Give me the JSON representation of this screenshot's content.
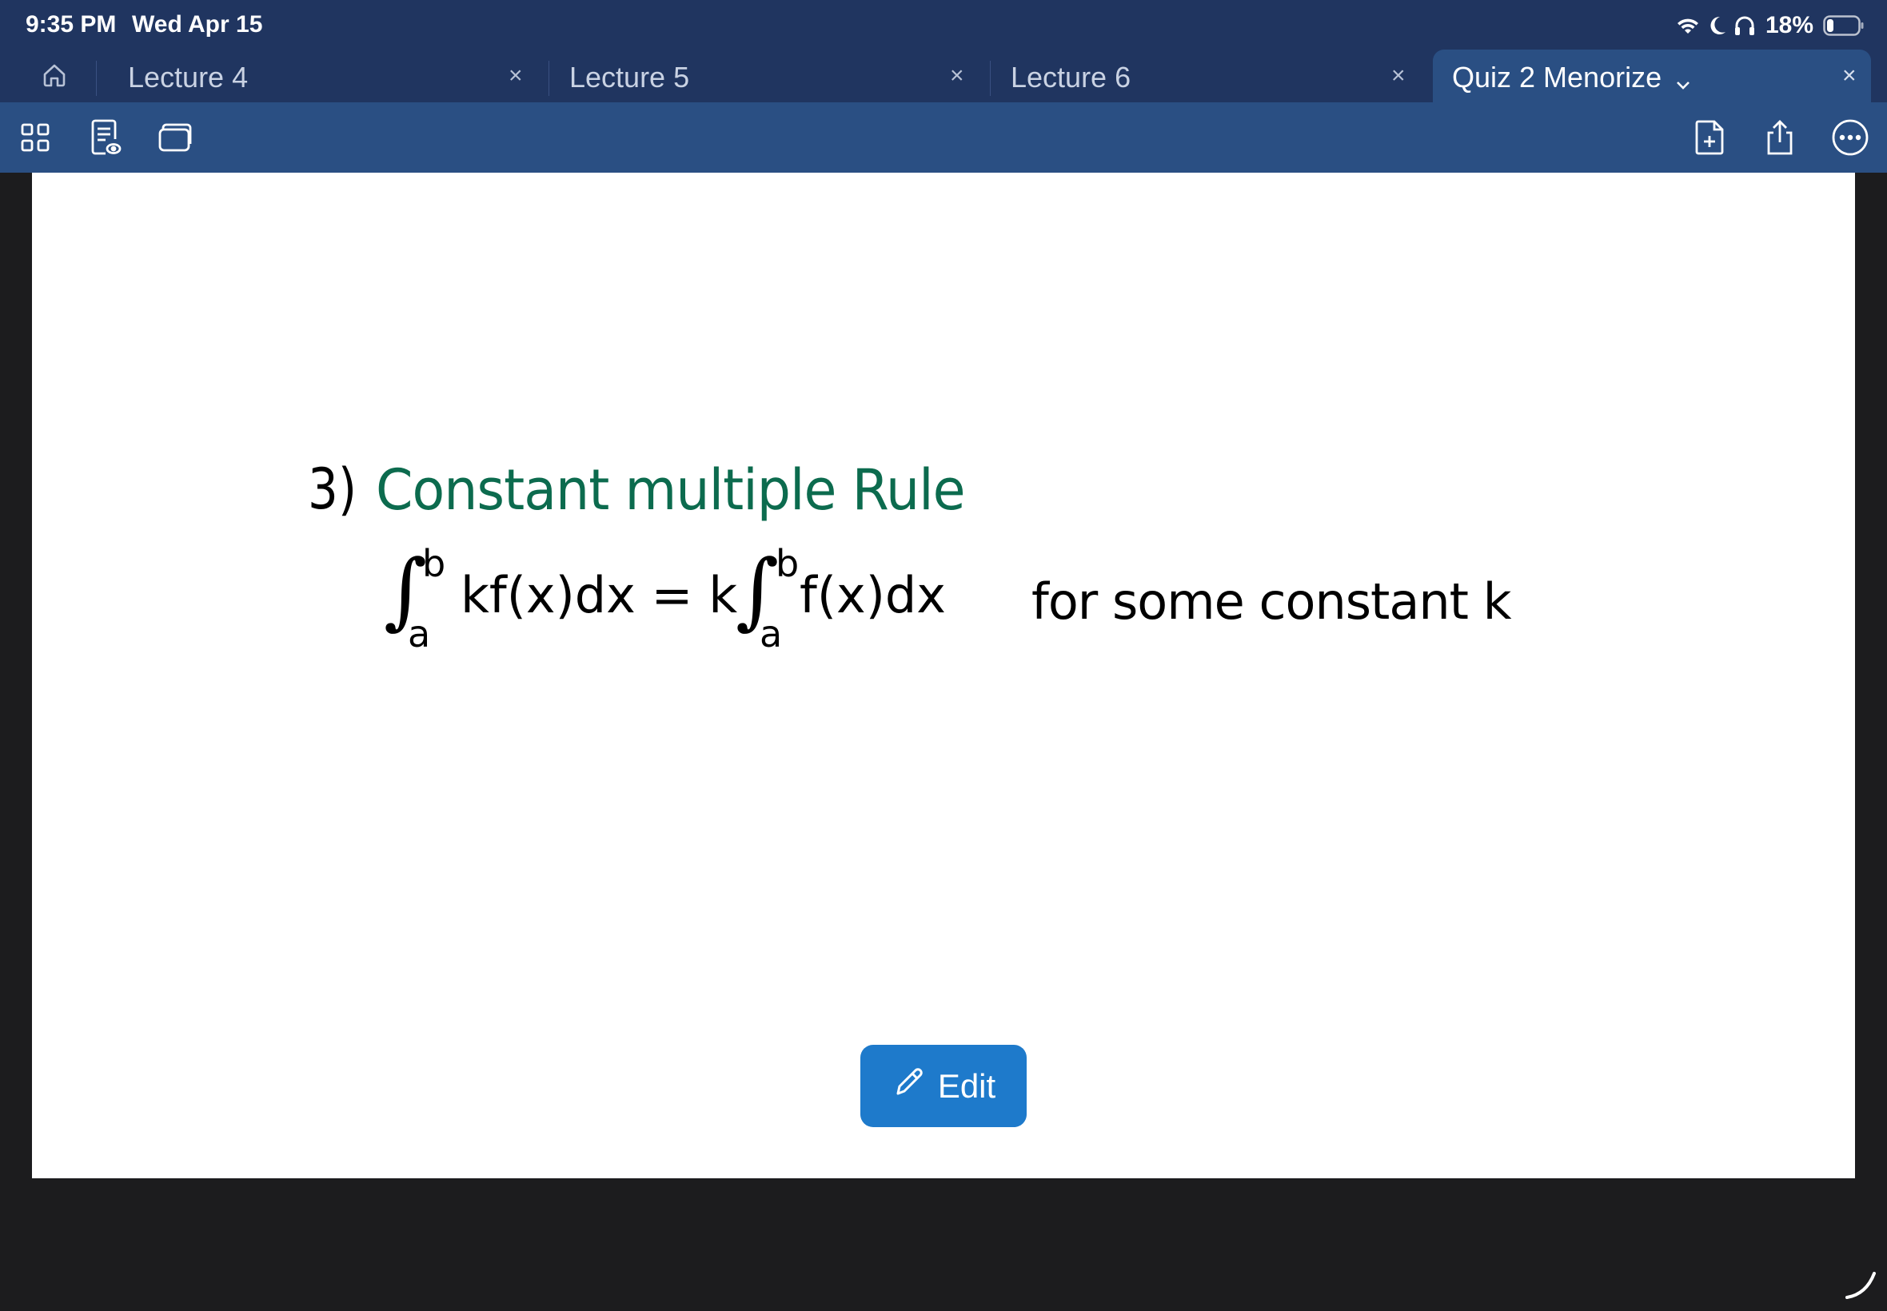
{
  "status_bar": {
    "time": "9:35 PM",
    "date": "Wed Apr 15",
    "battery_percent": "18%",
    "battery_level": 0.18,
    "icons": [
      "wifi-icon",
      "moon-icon",
      "headphones-icon",
      "battery-icon"
    ]
  },
  "tabs": [
    {
      "label": "Lecture 4",
      "close": "×",
      "active": false
    },
    {
      "label": "Lecture 5",
      "close": "×",
      "active": false
    },
    {
      "label": "Lecture 6",
      "close": "×",
      "active": false
    },
    {
      "label": "Quiz 2 Menorize",
      "dropdown": "⌄",
      "close": "×",
      "active": true
    }
  ],
  "toolbar": {
    "left_icons": [
      "grid-view-icon",
      "reader-mode-icon",
      "tabs-stack-icon"
    ],
    "right_icons": [
      "add-page-icon",
      "share-icon",
      "more-icon"
    ]
  },
  "note": {
    "number": "3)",
    "title": "Constant multiple Rule",
    "formula": {
      "upper_limit": "b",
      "lower_limit": "a",
      "left_integrand": "kf(x)dx = k",
      "right_integrand": "f(x)dx"
    },
    "annotation": "for some constant k"
  },
  "edit_button": {
    "label": "Edit"
  },
  "colors": {
    "status_bg": "#203560",
    "toolbar_bg": "#2a4f83",
    "title_ink": "#0c6b4e",
    "edit_button": "#1e7acb",
    "backdrop": "#1c1c1e"
  }
}
